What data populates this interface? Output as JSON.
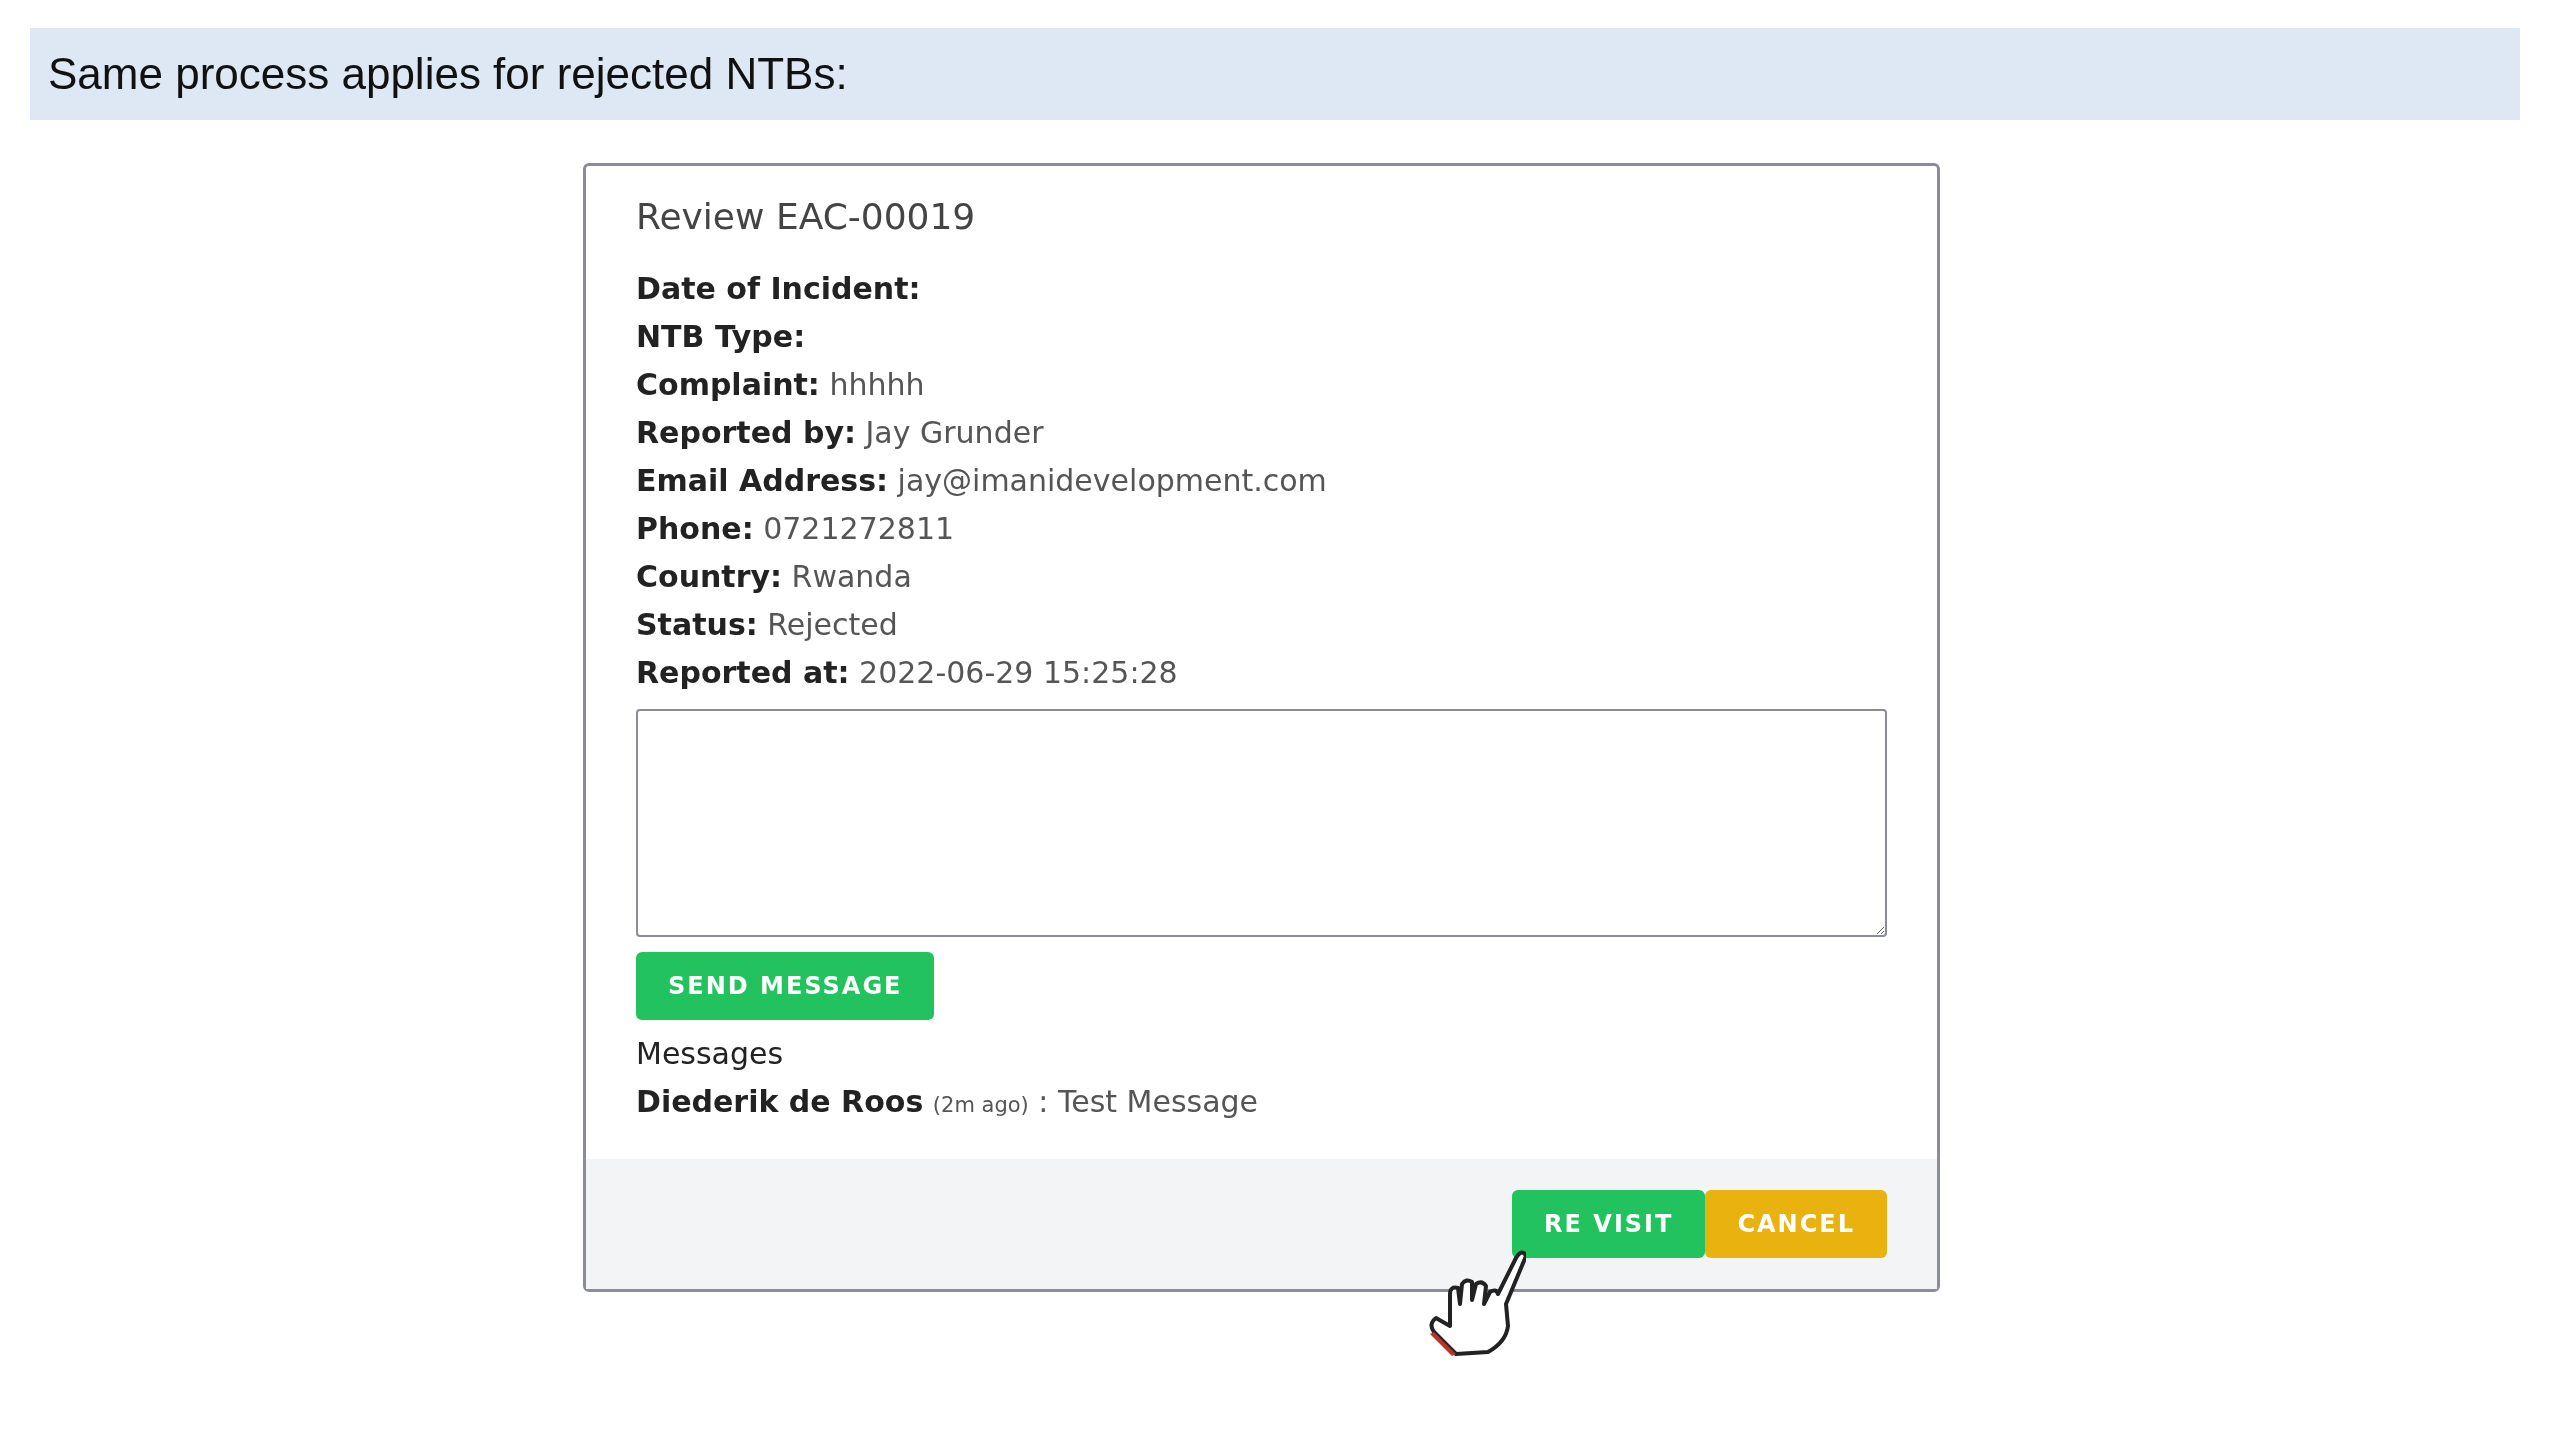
{
  "banner": {
    "text": "Same process applies for rejected NTBs:"
  },
  "modal": {
    "title": "Review EAC-00019",
    "fields": [
      {
        "label": "Date of Incident:"
      },
      {
        "label": "NTB Type:"
      },
      {
        "label": "Complaint:",
        "value": "hhhhh"
      },
      {
        "label": "Reported by:",
        "value": "Jay Grunder"
      },
      {
        "label": "Email Address:",
        "value": "jay@imanidevelopment.com"
      },
      {
        "label": "Phone:",
        "value": "0721272811"
      },
      {
        "label": "Country:",
        "value": "Rwanda"
      },
      {
        "label": "Status:",
        "value": "Rejected"
      },
      {
        "label": "Reported at:",
        "value": "2022-06-29 15:25:28"
      }
    ],
    "send_button": "SEND MESSAGE",
    "messages_heading": "Messages",
    "messages": [
      {
        "author": "Diederik de Roos",
        "time": "(2m ago)",
        "text": ": Test Message"
      }
    ],
    "footer_buttons": [
      {
        "label": "RE VISIT",
        "kind": "success"
      },
      {
        "label": "CANCEL",
        "kind": "warning"
      }
    ]
  }
}
